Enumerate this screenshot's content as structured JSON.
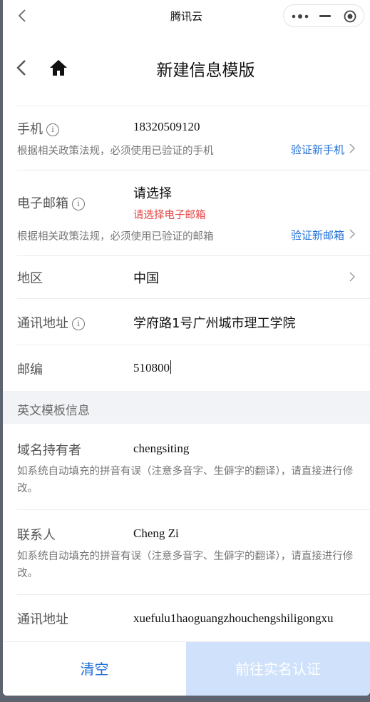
{
  "topbar": {
    "title": "腾讯云"
  },
  "header": {
    "title": "新建信息模版"
  },
  "phone_field": {
    "label": "手机",
    "value": "18320509120",
    "hint": "根据相关政策法规，必须使用已验证的手机",
    "link": "验证新手机"
  },
  "email_field": {
    "label": "电子邮箱",
    "value": "请选择",
    "error": "请选择电子邮箱",
    "hint": "根据相关政策法规，必须使用已验证的邮箱",
    "link": "验证新邮箱"
  },
  "region_field": {
    "label": "地区",
    "value": "中国"
  },
  "address_field": {
    "label": "通讯地址",
    "value": "学府路1号广州城市理工学院"
  },
  "postcode_field": {
    "label": "邮编",
    "value": "510800"
  },
  "english_section": {
    "title": "英文模板信息",
    "holder": {
      "label": "域名持有者",
      "value": "chengsiting",
      "hint": "如系统自动填充的拼音有误（注意多音字、生僻字的翻译），请直接进行修改。"
    },
    "contact": {
      "label": "联系人",
      "value": "Cheng Zi",
      "hint": "如系统自动填充的拼音有误（注意多音字、生僻字的翻译），请直接进行修改。"
    },
    "address": {
      "label": "通讯地址",
      "value": "xuefulu1haoguangzhouchengshiligongxu"
    }
  },
  "buttons": {
    "clear": "清空",
    "proceed": "前往实名认证"
  },
  "colors": {
    "link": "#1e6fd9",
    "error": "#e54545",
    "disabled_button": "#cfe1fb",
    "section_bg": "#f2f3f6"
  },
  "icons": [
    "back-arrow-icon",
    "more-dots-icon",
    "minimize-icon",
    "close-circle-icon",
    "home-icon",
    "info-circle-icon",
    "chevron-right-icon"
  ]
}
